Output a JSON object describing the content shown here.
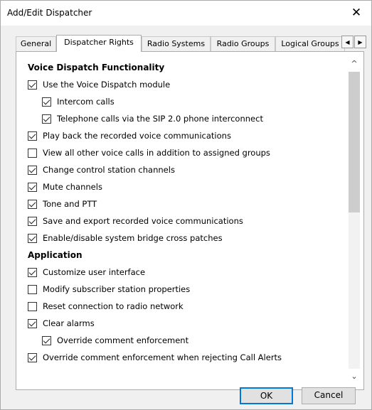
{
  "window": {
    "title": "Add/Edit Dispatcher",
    "close_glyph": "✕"
  },
  "tabs": [
    {
      "label": "General"
    },
    {
      "label": "Dispatcher Rights"
    },
    {
      "label": "Radio Systems"
    },
    {
      "label": "Radio Groups"
    },
    {
      "label": "Logical Groups"
    }
  ],
  "tab_scroll": {
    "left": "◀",
    "right": "▶"
  },
  "permissions": [
    {
      "type": "section",
      "label": "Voice Dispatch Functionality"
    },
    {
      "type": "check",
      "label": "Use the Voice Dispatch module",
      "checked": true,
      "indent": 0
    },
    {
      "type": "check",
      "label": "Intercom calls",
      "checked": true,
      "indent": 1
    },
    {
      "type": "check",
      "label": "Telephone calls via the SIP 2.0 phone interconnect",
      "checked": true,
      "indent": 1
    },
    {
      "type": "check",
      "label": "Play back the recorded voice communications",
      "checked": true,
      "indent": 0
    },
    {
      "type": "check",
      "label": "View all other voice calls in addition to assigned groups",
      "checked": false,
      "indent": 0
    },
    {
      "type": "check",
      "label": "Change control station channels",
      "checked": true,
      "indent": 0
    },
    {
      "type": "check",
      "label": "Mute channels",
      "checked": true,
      "indent": 0
    },
    {
      "type": "check",
      "label": "Tone and PTT",
      "checked": true,
      "indent": 0
    },
    {
      "type": "check",
      "label": "Save and export recorded voice communications",
      "checked": true,
      "indent": 0
    },
    {
      "type": "check",
      "label": "Enable/disable system bridge cross patches",
      "checked": true,
      "indent": 0
    },
    {
      "type": "section",
      "label": "Application"
    },
    {
      "type": "check",
      "label": "Customize user interface",
      "checked": true,
      "indent": 0
    },
    {
      "type": "check",
      "label": "Modify subscriber station properties",
      "checked": false,
      "indent": 0
    },
    {
      "type": "check",
      "label": "Reset connection to radio network",
      "checked": false,
      "indent": 0
    },
    {
      "type": "check",
      "label": "Clear alarms",
      "checked": true,
      "indent": 0
    },
    {
      "type": "check",
      "label": "Override comment enforcement",
      "checked": true,
      "indent": 1
    },
    {
      "type": "check",
      "label": "Override comment enforcement when rejecting Call Alerts",
      "checked": true,
      "indent": 0
    }
  ],
  "scrollbar": {
    "up": "^",
    "down": "⌄"
  },
  "buttons": {
    "ok": "OK",
    "cancel": "Cancel"
  }
}
